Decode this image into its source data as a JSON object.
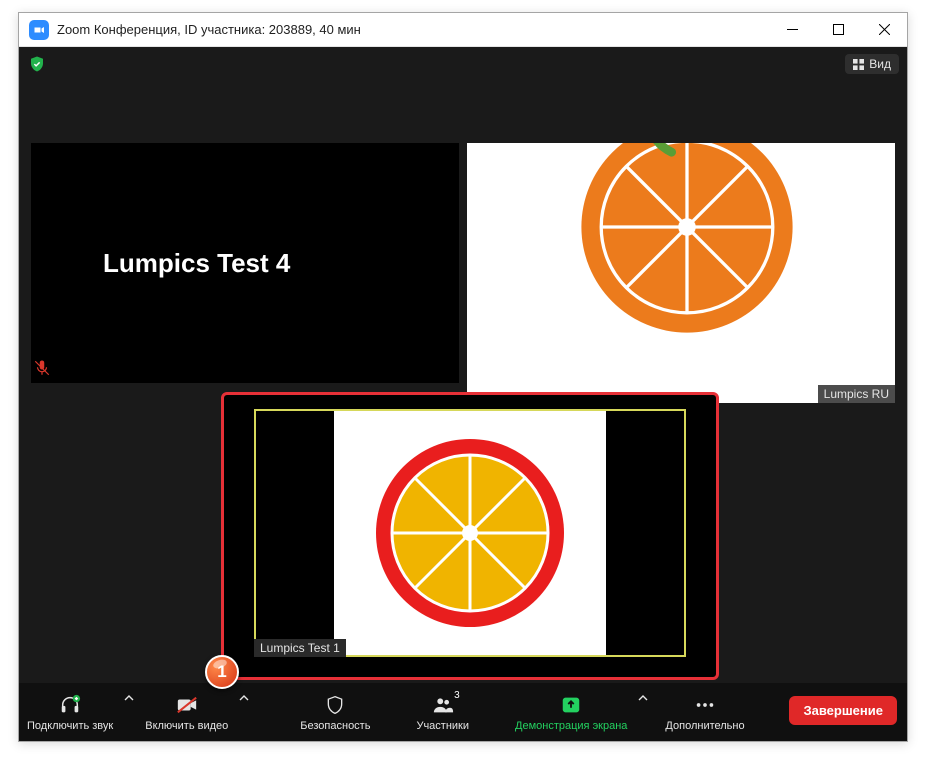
{
  "window": {
    "title": "Zoom Конференция, ID участника: 203889, 40 мин"
  },
  "top": {
    "view_label": "Вид"
  },
  "tiles": {
    "left_name": "Lumpics Test 4",
    "right_label": "Lumpics RU",
    "self_label": "Lumpics Test 1"
  },
  "callout": {
    "num": "1"
  },
  "toolbar": {
    "audio": "Подключить звук",
    "video": "Включить видео",
    "security": "Безопасность",
    "participants": "Участники",
    "participants_count": "3",
    "share": "Демонстрация экрана",
    "more": "Дополнительно",
    "end": "Завершение"
  }
}
